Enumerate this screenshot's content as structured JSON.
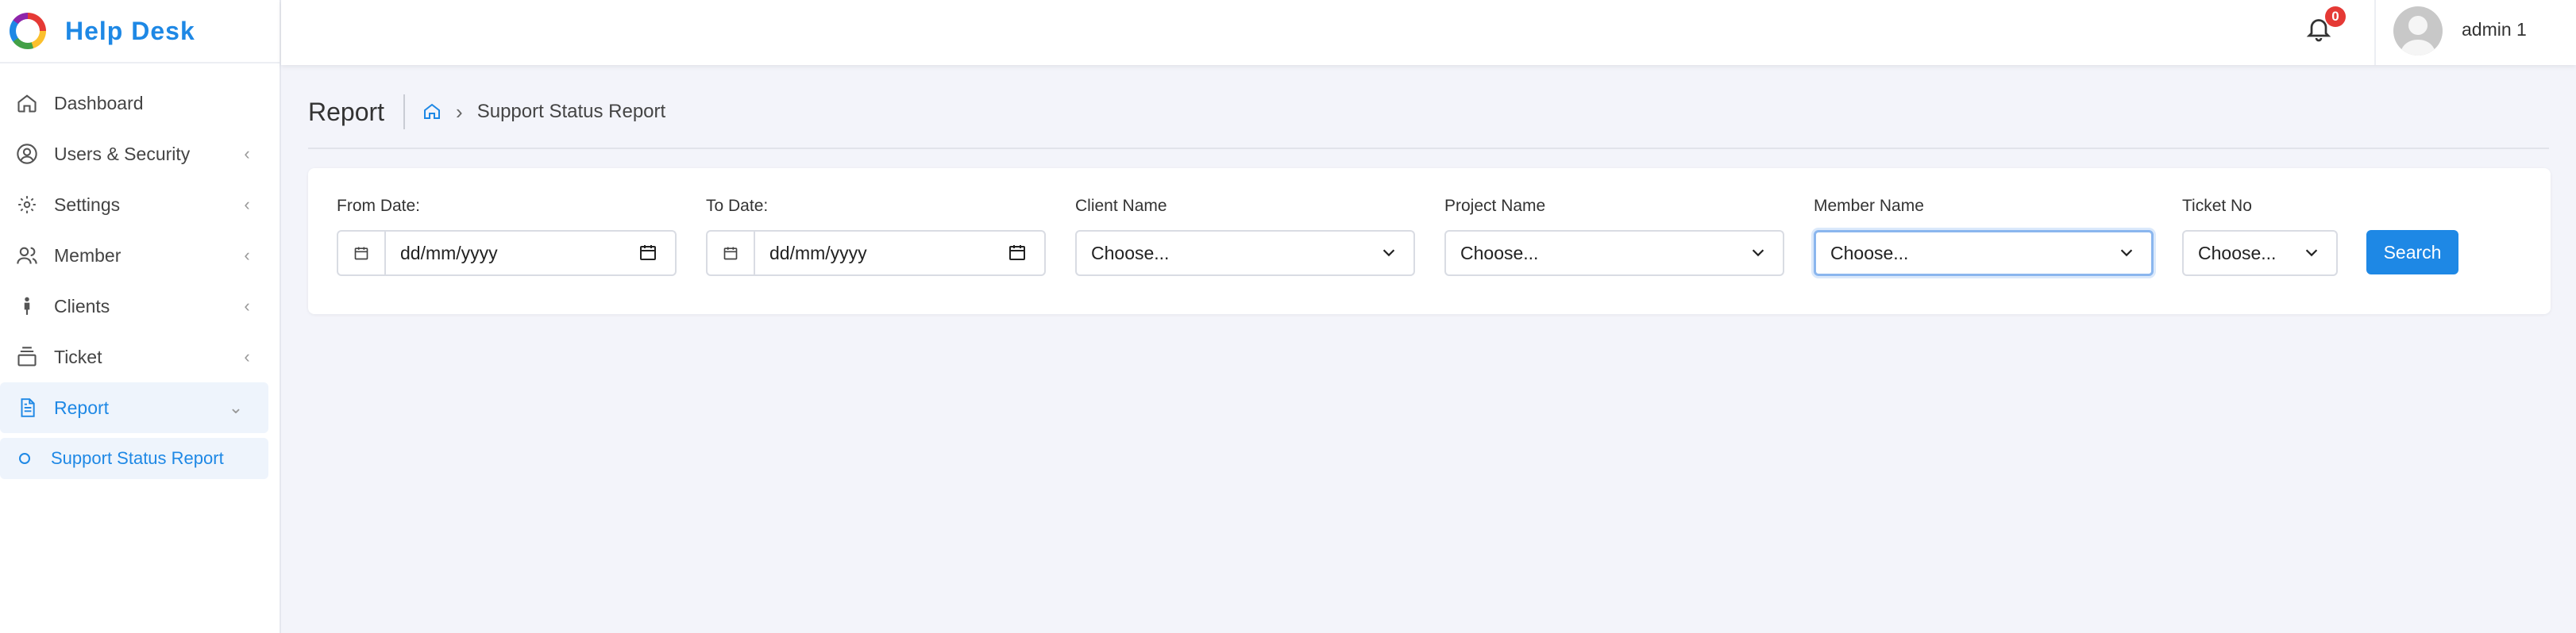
{
  "app": {
    "title": "Help Desk"
  },
  "colors": {
    "accent": "#1e88e5",
    "badge": "#e53935",
    "background": "#f3f4fa"
  },
  "sidebar": {
    "items": [
      {
        "label": "Dashboard",
        "icon": "home-icon"
      },
      {
        "label": "Users & Security",
        "icon": "user-circle-icon"
      },
      {
        "label": "Settings",
        "icon": "gear-icon"
      },
      {
        "label": "Member",
        "icon": "users-icon"
      },
      {
        "label": "Clients",
        "icon": "person-icon"
      },
      {
        "label": "Ticket",
        "icon": "stack-icon"
      },
      {
        "label": "Report",
        "icon": "document-icon"
      }
    ],
    "sub_items": [
      {
        "label": "Support Status Report"
      }
    ]
  },
  "topbar": {
    "notification_count": "0",
    "username": "admin 1"
  },
  "page": {
    "title": "Report",
    "breadcrumb": "Support Status Report"
  },
  "filters": {
    "from_date": {
      "label": "From Date:",
      "value": "dd/mm/yyyy"
    },
    "to_date": {
      "label": "To Date:",
      "value": "dd/mm/yyyy"
    },
    "client_name": {
      "label": "Client Name",
      "value": "Choose..."
    },
    "project_name": {
      "label": "Project Name",
      "value": "Choose..."
    },
    "member_name": {
      "label": "Member Name",
      "value": "Choose..."
    },
    "ticket_no": {
      "label": "Ticket No",
      "value": "Choose..."
    },
    "search_label": "Search"
  }
}
